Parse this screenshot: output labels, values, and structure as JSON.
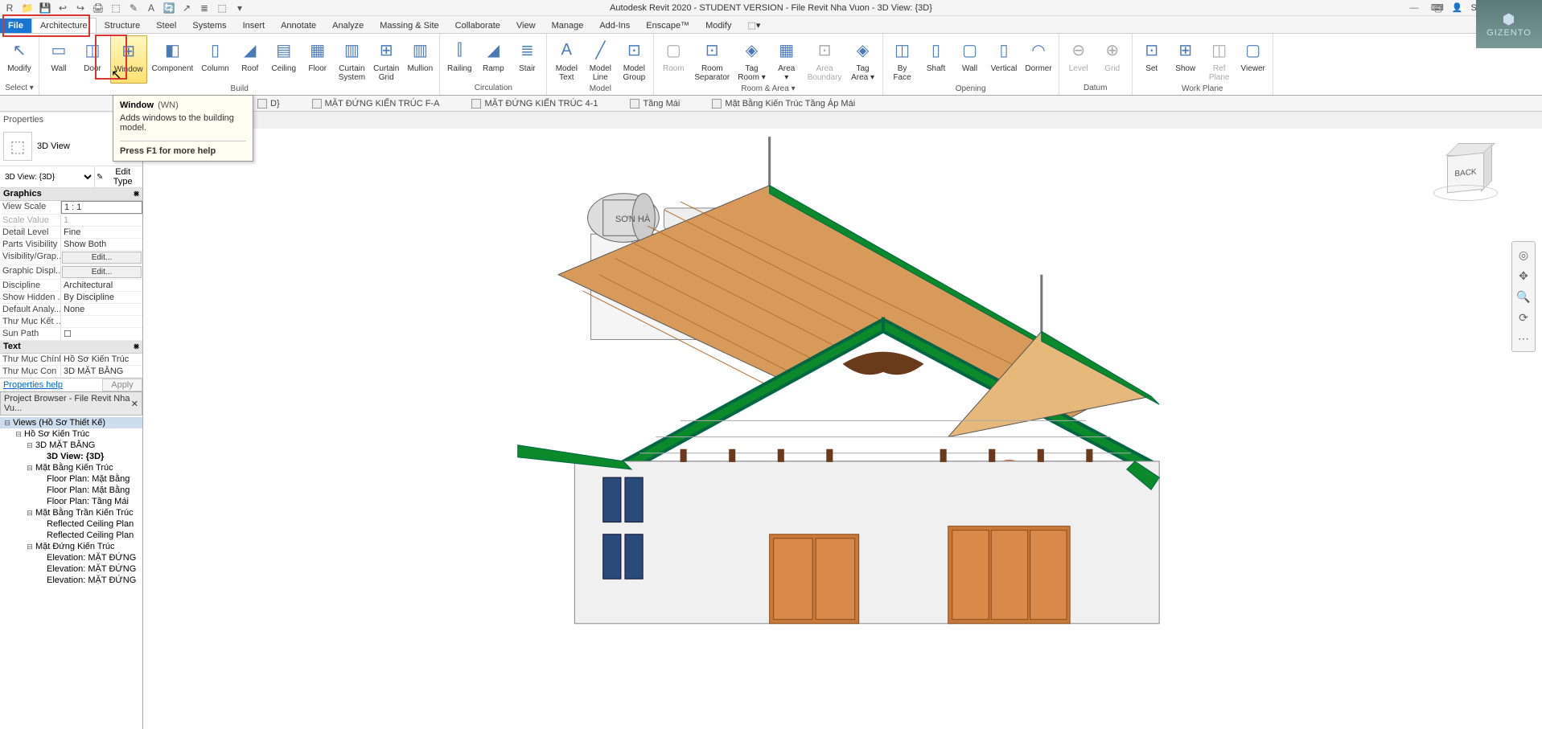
{
  "app": {
    "title": "Autodesk Revit 2020 - STUDENT VERSION - File Revit Nha Vuon - 3D View: {3D}",
    "sign_in": "Sign In"
  },
  "qat": [
    "R",
    "📁",
    "💾",
    "↩",
    "↪",
    "🖨",
    "⬚",
    "✎",
    "A",
    "🔄",
    "↗",
    "≣",
    "⬚",
    "▾"
  ],
  "ribbon_tabs": [
    "File",
    "Architecture",
    "Structure",
    "Steel",
    "Systems",
    "Insert",
    "Annotate",
    "Analyze",
    "Massing & Site",
    "Collaborate",
    "View",
    "Manage",
    "Add-Ins",
    "Enscape™",
    "Modify",
    "⬚▾"
  ],
  "active_ribbon_tab": "Architecture",
  "ribbon_groups": [
    {
      "title": "Select ▾",
      "items": [
        {
          "label": "Modify",
          "icon": "↖"
        }
      ]
    },
    {
      "title": "Build",
      "items": [
        {
          "label": "Wall",
          "icon": "▭"
        },
        {
          "label": "Door",
          "icon": "◫"
        },
        {
          "label": "Window",
          "icon": "⊞",
          "hl": true
        },
        {
          "label": "Component",
          "icon": "◧"
        },
        {
          "label": "Column",
          "icon": "▯"
        },
        {
          "label": "Roof",
          "icon": "◢"
        },
        {
          "label": "Ceiling",
          "icon": "▤"
        },
        {
          "label": "Floor",
          "icon": "▦"
        },
        {
          "label": "Curtain\nSystem",
          "icon": "▥"
        },
        {
          "label": "Curtain\nGrid",
          "icon": "⊞"
        },
        {
          "label": "Mullion",
          "icon": "▥"
        }
      ]
    },
    {
      "title": "Circulation",
      "items": [
        {
          "label": "Railing",
          "icon": "⫿"
        },
        {
          "label": "Ramp",
          "icon": "◢"
        },
        {
          "label": "Stair",
          "icon": "≣"
        }
      ]
    },
    {
      "title": "Model",
      "items": [
        {
          "label": "Model\nText",
          "icon": "A"
        },
        {
          "label": "Model\nLine",
          "icon": "╱"
        },
        {
          "label": "Model\nGroup",
          "icon": "⊡"
        }
      ]
    },
    {
      "title": "Room & Area ▾",
      "items": [
        {
          "label": "Room",
          "icon": "▢",
          "disabled": true
        },
        {
          "label": "Room\nSeparator",
          "icon": "⊡"
        },
        {
          "label": "Tag\nRoom ▾",
          "icon": "◈"
        },
        {
          "label": "Area\n▾",
          "icon": "▦"
        },
        {
          "label": "Area\nBoundary",
          "icon": "⊡",
          "disabled": true
        },
        {
          "label": "Tag\nArea ▾",
          "icon": "◈"
        }
      ]
    },
    {
      "title": "Opening",
      "items": [
        {
          "label": "By\nFace",
          "icon": "◫"
        },
        {
          "label": "Shaft",
          "icon": "▯"
        },
        {
          "label": "Wall",
          "icon": "▢"
        },
        {
          "label": "Vertical",
          "icon": "▯"
        },
        {
          "label": "Dormer",
          "icon": "◠"
        }
      ]
    },
    {
      "title": "Datum",
      "items": [
        {
          "label": "Level",
          "icon": "⊖",
          "disabled": true
        },
        {
          "label": "Grid",
          "icon": "⊕",
          "disabled": true
        }
      ]
    },
    {
      "title": "Work Plane",
      "items": [
        {
          "label": "Set",
          "icon": "⊡"
        },
        {
          "label": "Show",
          "icon": "⊞"
        },
        {
          "label": "Ref\nPlane",
          "icon": "◫",
          "disabled": true
        },
        {
          "label": "Viewer",
          "icon": "▢"
        }
      ]
    }
  ],
  "tooltip": {
    "title": "Window",
    "shortcut": "(WN)",
    "desc": "Adds windows to the building model.",
    "help": "Press F1 for more help"
  },
  "view_tabs": [
    {
      "label": "D}"
    },
    {
      "label": "MẶT ĐỨNG KIẾN TRÚC F-A"
    },
    {
      "label": "MẶT ĐỨNG KIẾN TRÚC 4-1"
    },
    {
      "label": "Tầng Mái"
    },
    {
      "label": "Mặt Bằng Kiến Trúc Tầng Áp Mái"
    }
  ],
  "properties": {
    "panel_title": "Properties",
    "type_name": "3D View",
    "selector": "3D View: {3D}",
    "edit_type": "Edit Type",
    "sections": [
      {
        "name": "Graphics",
        "rows": [
          {
            "k": "View Scale",
            "v": "1 : 1",
            "boxed": true
          },
          {
            "k": "Scale Value",
            "v": "1",
            "dim": true
          },
          {
            "k": "Detail Level",
            "v": "Fine"
          },
          {
            "k": "Parts Visibility",
            "v": "Show Both"
          },
          {
            "k": "Visibility/Grap...",
            "v": "Edit...",
            "btn": true
          },
          {
            "k": "Graphic Displ...",
            "v": "Edit...",
            "btn": true
          },
          {
            "k": "Discipline",
            "v": "Architectural"
          },
          {
            "k": "Show Hidden ...",
            "v": "By Discipline"
          },
          {
            "k": "Default Analy...",
            "v": "None"
          },
          {
            "k": "Thư Mục Kết ...",
            "v": ""
          },
          {
            "k": "Sun Path",
            "v": "☐"
          }
        ]
      },
      {
        "name": "Text",
        "rows": [
          {
            "k": "Thư Mục Chính",
            "v": "Hồ Sơ Kiến Trúc"
          },
          {
            "k": "Thư Mục Con",
            "v": "3D MẶT BẰNG"
          }
        ]
      }
    ],
    "help_link": "Properties help",
    "apply": "Apply"
  },
  "project_browser": {
    "title": "Project Browser - File Revit Nha Vu...",
    "tree": [
      {
        "ind": 0,
        "tg": "⊟",
        "label": "Views (Hồ Sơ Thiết Kế)",
        "sel": true
      },
      {
        "ind": 1,
        "tg": "⊟",
        "label": "Hồ Sơ Kiến Trúc"
      },
      {
        "ind": 2,
        "tg": "⊟",
        "label": "3D MẶT BẰNG"
      },
      {
        "ind": 3,
        "tg": "",
        "label": "3D View: {3D}",
        "bold": true
      },
      {
        "ind": 2,
        "tg": "⊟",
        "label": "Mặt Bằng Kiến Trúc"
      },
      {
        "ind": 3,
        "tg": "",
        "label": "Floor Plan: Mặt Bằng"
      },
      {
        "ind": 3,
        "tg": "",
        "label": "Floor Plan: Mặt Bằng"
      },
      {
        "ind": 3,
        "tg": "",
        "label": "Floor Plan: Tầng Mái"
      },
      {
        "ind": 2,
        "tg": "⊟",
        "label": "Mặt Bằng Trần Kiến Trúc"
      },
      {
        "ind": 3,
        "tg": "",
        "label": "Reflected Ceiling Plan"
      },
      {
        "ind": 3,
        "tg": "",
        "label": "Reflected Ceiling Plan"
      },
      {
        "ind": 2,
        "tg": "⊟",
        "label": "Mặt Đứng Kiến Trúc"
      },
      {
        "ind": 3,
        "tg": "",
        "label": "Elevation: MẶT ĐỨNG"
      },
      {
        "ind": 3,
        "tg": "",
        "label": "Elevation: MẶT ĐỨNG"
      },
      {
        "ind": 3,
        "tg": "",
        "label": "Elevation: MẶT ĐỨNG"
      }
    ]
  },
  "viewcube": {
    "face": "BACK"
  },
  "watermark": {
    "brand": "GIZENTO",
    "logo": "⬢"
  }
}
